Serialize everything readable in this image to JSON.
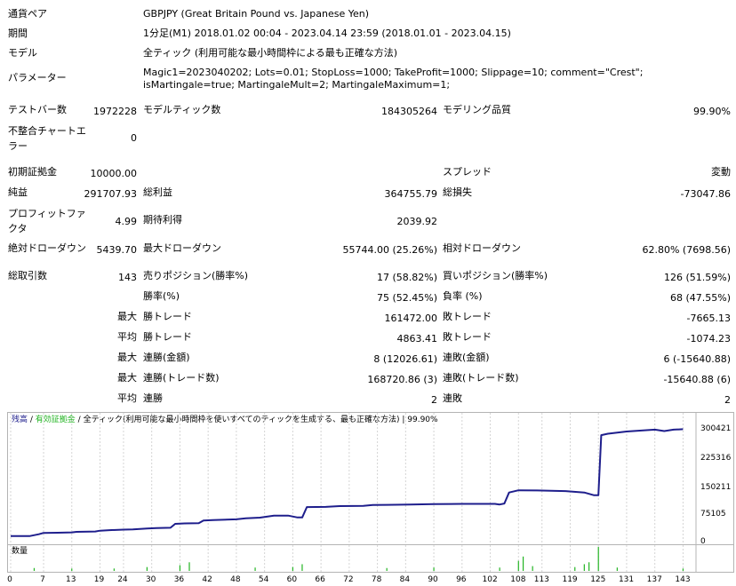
{
  "rows": {
    "symbol": {
      "label": "通貨ペア",
      "value": "GBPJPY (Great Britain Pound vs. Japanese Yen)"
    },
    "period": {
      "label": "期間",
      "value": "1分足(M1) 2018.01.02 00:04 - 2023.04.14 23:59 (2018.01.01 - 2023.04.15)"
    },
    "model": {
      "label": "モデル",
      "value": "全ティック (利用可能な最小時間枠による最も正確な方法)"
    },
    "params": {
      "label": "パラメーター",
      "value": "Magic1=2023040202; Lots=0.01; StopLoss=1000; TakeProfit=1000; Slippage=10; comment=\"Crest\"; isMartingale=true; MartingaleMult=2; MartingaleMaximum=1;"
    }
  },
  "stats": {
    "bars_label": "テストバー数",
    "bars": "1972228",
    "ticks_label": "モデルティック数",
    "ticks": "184305264",
    "quality_label": "モデリング品質",
    "quality": "99.90%",
    "mismatch_label": "不整合チャートエラー",
    "mismatch": "0",
    "deposit_label": "初期証拠金",
    "deposit": "10000.00",
    "spread_label": "スプレッド",
    "spread": "変動",
    "net_label": "純益",
    "net": "291707.93",
    "gross_profit_label": "総利益",
    "gross_profit": "364755.79",
    "gross_loss_label": "総損失",
    "gross_loss": "-73047.86",
    "pf_label": "プロフィットファクタ",
    "pf": "4.99",
    "expected_label": "期待利得",
    "expected": "2039.92",
    "abs_dd_label": "絶対ドローダウン",
    "abs_dd": "5439.70",
    "max_dd_label": "最大ドローダウン",
    "max_dd": "55744.00 (25.26%)",
    "rel_dd_label": "相対ドローダウン",
    "rel_dd": "62.80% (7698.56)",
    "trades_label": "総取引数",
    "trades": "143",
    "short_label": "売りポジション(勝率%)",
    "short": "17 (58.82%)",
    "long_label": "買いポジション(勝率%)",
    "long": "126 (51.59%)",
    "win_rate_label": "勝率(%)",
    "win_rate": "75 (52.45%)",
    "loss_rate_label": "負率 (%)",
    "loss_rate": "68 (47.55%)",
    "max_prefix": "最大",
    "avg_prefix": "平均",
    "win_trade_label": "勝トレード",
    "loss_trade_label": "敗トレード",
    "max_win": "161472.00",
    "max_loss": "-7665.13",
    "avg_win": "4863.41",
    "avg_loss": "-1074.23",
    "consec_win_money_label": "連勝(金額)",
    "consec_win_money": "8 (12026.61)",
    "consec_loss_money_label": "連敗(金額)",
    "consec_loss_money": "6 (-15640.88)",
    "consec_win_trades_label": "連勝(トレード数)",
    "consec_win_trades": "168720.86 (3)",
    "consec_loss_trades_label": "連敗(トレード数)",
    "consec_loss_trades": "-15640.88 (6)",
    "consec_win_label": "連勝",
    "consec_win": "2",
    "consec_loss_label": "連敗",
    "consec_loss": "2"
  },
  "chart_data": {
    "type": "line",
    "legend": {
      "balance": "残高",
      "sep1": " / ",
      "equity": "有効証拠金",
      "sep2": " / ",
      "info": "全ティック(利用可能な最小時間枠を使いすべてのティックを生成する、最も正確な方法) | 99.90%"
    },
    "colors": {
      "balance": "#1e1e8c",
      "volume": "#22b422",
      "grid": "#d4d4d4"
    },
    "yticks": [
      "300421",
      "225316",
      "150211",
      "75105",
      "0"
    ],
    "ylim": [
      0,
      300421
    ],
    "xlim": [
      0,
      145
    ],
    "xticks": [
      "0",
      "7",
      "13",
      "19",
      "24",
      "30",
      "36",
      "42",
      "48",
      "54",
      "60",
      "66",
      "72",
      "78",
      "84",
      "90",
      "96",
      "102",
      "108",
      "113",
      "119",
      "125",
      "131",
      "137",
      "143"
    ],
    "series": [
      {
        "values": [
          [
            0,
            10000
          ],
          [
            4,
            10000
          ],
          [
            6,
            15000
          ],
          [
            7,
            18500
          ],
          [
            10,
            19000
          ],
          [
            13,
            20000
          ],
          [
            14,
            21500
          ],
          [
            18,
            22500
          ],
          [
            19,
            24500
          ],
          [
            21,
            26000
          ],
          [
            24,
            27500
          ],
          [
            26,
            28000
          ],
          [
            29,
            30500
          ],
          [
            31,
            31500
          ],
          [
            34,
            32500
          ],
          [
            35,
            43000
          ],
          [
            37,
            44000
          ],
          [
            40,
            44500
          ],
          [
            41,
            52000
          ],
          [
            43,
            53000
          ],
          [
            48,
            55000
          ],
          [
            50,
            58000
          ],
          [
            53,
            59500
          ],
          [
            56,
            65000
          ],
          [
            59,
            65000
          ],
          [
            61,
            60000
          ],
          [
            62,
            60000
          ],
          [
            63,
            88000
          ],
          [
            67,
            88500
          ],
          [
            70,
            90500
          ],
          [
            75,
            91000
          ],
          [
            77,
            93500
          ],
          [
            80,
            94000
          ],
          [
            85,
            95000
          ],
          [
            90,
            96000
          ],
          [
            96,
            96500
          ],
          [
            100,
            96500
          ],
          [
            103,
            96500
          ],
          [
            104,
            95000
          ],
          [
            105,
            97500
          ],
          [
            106,
            127000
          ],
          [
            108,
            133000
          ],
          [
            112,
            132500
          ],
          [
            118,
            131000
          ],
          [
            122,
            127000
          ],
          [
            124,
            120000
          ],
          [
            125,
            120000
          ],
          [
            125.6,
            281000
          ],
          [
            127,
            285000
          ],
          [
            131,
            291000
          ],
          [
            137,
            296000
          ],
          [
            139,
            292000
          ],
          [
            141,
            296000
          ],
          [
            143,
            297000
          ]
        ]
      }
    ],
    "volume_label": "数量",
    "volume": [
      [
        5,
        0.12
      ],
      [
        13,
        0.1
      ],
      [
        22,
        0.1
      ],
      [
        29,
        0.16
      ],
      [
        36,
        0.24
      ],
      [
        38,
        0.36
      ],
      [
        52,
        0.14
      ],
      [
        60,
        0.16
      ],
      [
        62,
        0.28
      ],
      [
        80,
        0.12
      ],
      [
        90,
        0.14
      ],
      [
        104,
        0.14
      ],
      [
        108,
        0.42
      ],
      [
        109,
        0.6
      ],
      [
        111,
        0.2
      ],
      [
        120,
        0.16
      ],
      [
        122,
        0.28
      ],
      [
        123,
        0.36
      ],
      [
        125,
        1.0
      ],
      [
        129,
        0.14
      ],
      [
        143,
        0.1
      ]
    ]
  }
}
